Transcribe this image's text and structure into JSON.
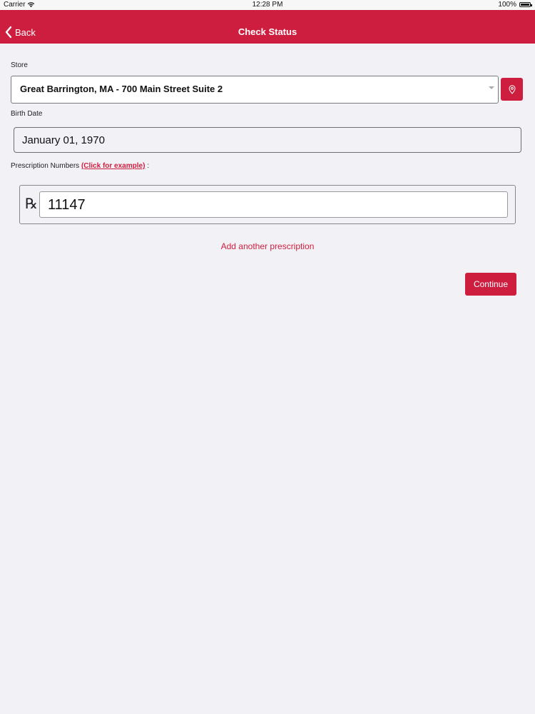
{
  "status_bar": {
    "carrier": "Carrier",
    "time": "12:28 PM",
    "battery": "100%",
    "wifi_icon": "wifi-icon",
    "battery_icon": "battery-icon"
  },
  "nav": {
    "back_label": "Back",
    "title": "Check Status",
    "back_icon": "chevron-left-icon",
    "color": "#ce1e3f"
  },
  "form": {
    "store": {
      "label": "Store",
      "value": "Great Barrington, MA - 700 Main Street Suite 2",
      "locate_icon": "map-pin-icon"
    },
    "birth_date": {
      "label": "Birth Date",
      "value": "January 01, 1970"
    },
    "prescriptions": {
      "label": "Prescription Numbers",
      "example_link": "(Click for example)",
      "label_suffix": ":",
      "rx_symbol": "℞",
      "items": [
        "11147"
      ]
    },
    "add_link": "Add another prescription",
    "continue_label": "Continue"
  }
}
